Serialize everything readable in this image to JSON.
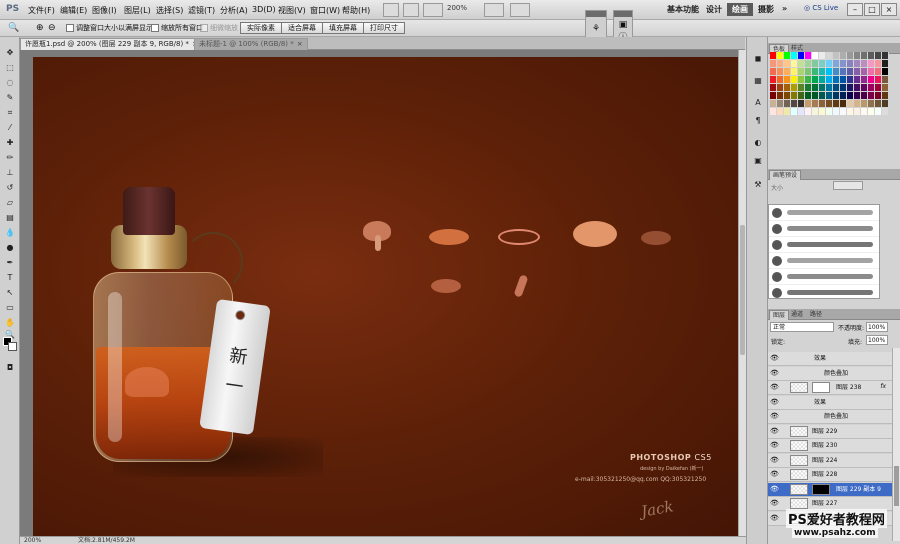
{
  "app": {
    "logo": "PS"
  },
  "menu": [
    "文件(F)",
    "编辑(E)",
    "图像(I)",
    "图层(L)",
    "选择(S)",
    "滤镜(T)",
    "分析(A)",
    "3D(D)",
    "视图(V)",
    "窗口(W)",
    "帮助(H)"
  ],
  "toolbar": {
    "zoom_value": "200%"
  },
  "workspace": {
    "items": [
      "基本功能",
      "设计",
      "绘画",
      "摄影",
      "»"
    ],
    "active": "绘画",
    "cs_live": "CS Live"
  },
  "options": {
    "checkbox1": "调整窗口大小以满屏显示",
    "checkbox2": "缩放所有窗口",
    "checkbox3": "细微缩放",
    "buttons": [
      "实际像素",
      "适合屏幕",
      "填充屏幕",
      "打印尺寸"
    ]
  },
  "tabs": [
    {
      "label": "许愿瓶1.psd @ 200% (图层 229 副本 9, RGB/8) *",
      "active": true
    },
    {
      "label": "未标题-1 @ 100% (RGB/8) *",
      "active": false
    }
  ],
  "canvas_text": {
    "tag": [
      "新",
      "一"
    ],
    "brand": "PHOTOSHOP",
    "brand_version": "CS5",
    "design_by": "design by Daikefan (新一)",
    "contact": "e-mail:305321250@qq.com QQ:305321250",
    "signature": "Jack"
  },
  "status": {
    "zoom": "200%",
    "doc": "文档:2.81M/459.2M"
  },
  "panels": {
    "swatches_tabs": [
      "色板",
      "样式"
    ],
    "brush_tabs": [
      "画笔预设"
    ],
    "brush_size_label": "大小",
    "layers_tabs": [
      "图层",
      "通道",
      "路径"
    ],
    "blend_mode": "正常",
    "opacity_label": "不透明度:",
    "opacity_value": "100%",
    "lock_label": "锁定:",
    "fill_label": "填充:",
    "fill_value": "100%",
    "layers": [
      {
        "name": "效果",
        "kind": "effect"
      },
      {
        "name": "颜色叠加",
        "kind": "sub-effect"
      },
      {
        "name": "图层 238",
        "kind": "layer",
        "fx": true,
        "mask": true
      },
      {
        "name": "效果",
        "kind": "effect"
      },
      {
        "name": "颜色叠加",
        "kind": "sub-effect"
      },
      {
        "name": "图层 229",
        "kind": "layer"
      },
      {
        "name": "图层 230",
        "kind": "layer"
      },
      {
        "name": "图层 224",
        "kind": "layer"
      },
      {
        "name": "图层 228",
        "kind": "layer"
      },
      {
        "name": "图层 229 副本 9",
        "kind": "layer",
        "selected": true,
        "mask": true
      },
      {
        "name": "图层 227",
        "kind": "layer"
      },
      {
        "name": "图层 226",
        "kind": "layer"
      }
    ]
  },
  "watermark": {
    "title": "PS爱好者教程网",
    "url": "www.psahz.com"
  },
  "colors": {
    "canvas": "#5e2108",
    "selected_layer": "#3d6bc6",
    "workspace_active": "#5a5a5a"
  }
}
